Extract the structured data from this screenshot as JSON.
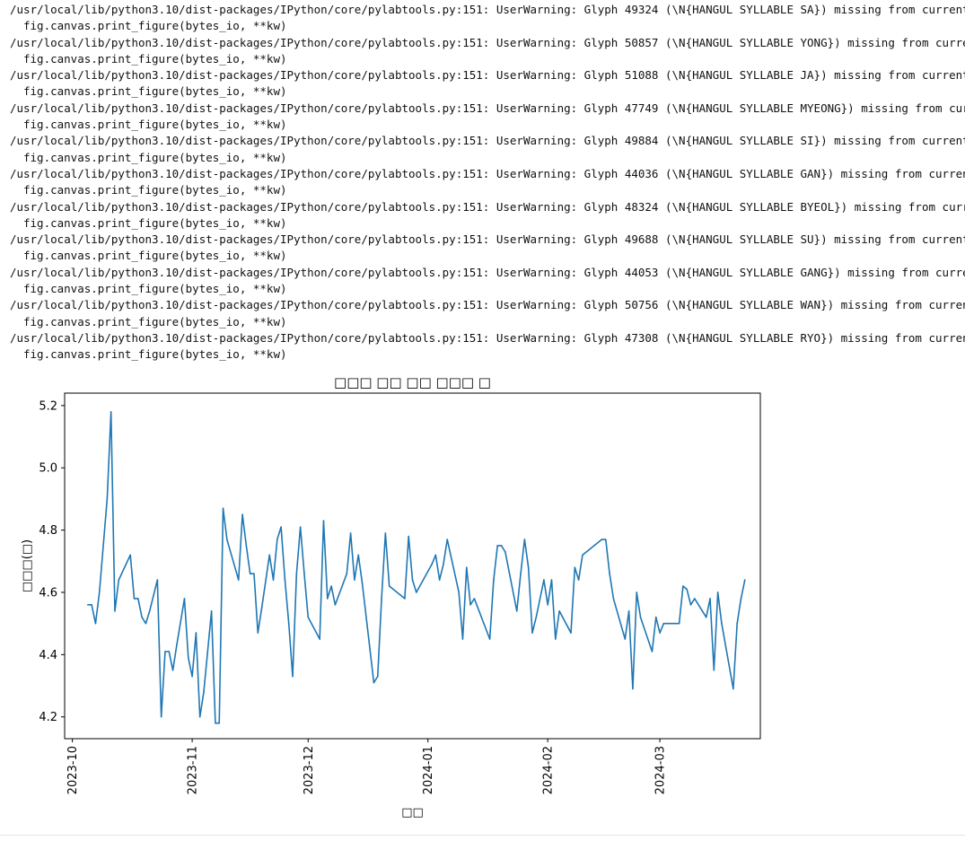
{
  "output": {
    "warnings": [
      {
        "line": "/usr/local/lib/python3.10/dist-packages/IPython/core/pylabtools.py:151: UserWarning: Glyph 49324 (\\N{HANGUL SYLLABLE SA}) missing from current font.",
        "cont": "fig.canvas.print_figure(bytes_io, **kw)"
      },
      {
        "line": "/usr/local/lib/python3.10/dist-packages/IPython/core/pylabtools.py:151: UserWarning: Glyph 50857 (\\N{HANGUL SYLLABLE YONG}) missing from current font.",
        "cont": "fig.canvas.print_figure(bytes_io, **kw)"
      },
      {
        "line": "/usr/local/lib/python3.10/dist-packages/IPython/core/pylabtools.py:151: UserWarning: Glyph 51088 (\\N{HANGUL SYLLABLE JA}) missing from current font.",
        "cont": "fig.canvas.print_figure(bytes_io, **kw)"
      },
      {
        "line": "/usr/local/lib/python3.10/dist-packages/IPython/core/pylabtools.py:151: UserWarning: Glyph 47749 (\\N{HANGUL SYLLABLE MYEONG}) missing from current font.",
        "cont": "fig.canvas.print_figure(bytes_io, **kw)"
      },
      {
        "line": "/usr/local/lib/python3.10/dist-packages/IPython/core/pylabtools.py:151: UserWarning: Glyph 49884 (\\N{HANGUL SYLLABLE SI}) missing from current font.",
        "cont": "fig.canvas.print_figure(bytes_io, **kw)"
      },
      {
        "line": "/usr/local/lib/python3.10/dist-packages/IPython/core/pylabtools.py:151: UserWarning: Glyph 44036 (\\N{HANGUL SYLLABLE GAN}) missing from current font.",
        "cont": "fig.canvas.print_figure(bytes_io, **kw)"
      },
      {
        "line": "/usr/local/lib/python3.10/dist-packages/IPython/core/pylabtools.py:151: UserWarning: Glyph 48324 (\\N{HANGUL SYLLABLE BYEOL}) missing from current font.",
        "cont": "fig.canvas.print_figure(bytes_io, **kw)"
      },
      {
        "line": "/usr/local/lib/python3.10/dist-packages/IPython/core/pylabtools.py:151: UserWarning: Glyph 49688 (\\N{HANGUL SYLLABLE SU}) missing from current font.",
        "cont": "fig.canvas.print_figure(bytes_io, **kw)"
      },
      {
        "line": "/usr/local/lib/python3.10/dist-packages/IPython/core/pylabtools.py:151: UserWarning: Glyph 44053 (\\N{HANGUL SYLLABLE GANG}) missing from current font.",
        "cont": "fig.canvas.print_figure(bytes_io, **kw)"
      },
      {
        "line": "/usr/local/lib/python3.10/dist-packages/IPython/core/pylabtools.py:151: UserWarning: Glyph 50756 (\\N{HANGUL SYLLABLE WAN}) missing from current font.",
        "cont": "fig.canvas.print_figure(bytes_io, **kw)"
      },
      {
        "line": "/usr/local/lib/python3.10/dist-packages/IPython/core/pylabtools.py:151: UserWarning: Glyph 47308 (\\N{HANGUL SYLLABLE RYO}) missing from current font.",
        "cont": "fig.canvas.print_figure(bytes_io, **kw)"
      }
    ]
  },
  "chart_data": {
    "type": "line",
    "title": "□□□ □□ □□ □□□ □",
    "xlabel": "□□",
    "ylabel": "□□□(□)",
    "line_color": "#1f77b4",
    "xlim": [
      "2023-09-29",
      "2024-03-27"
    ],
    "ylim": [
      4.13,
      5.24
    ],
    "x_ticks": [
      "2023-10",
      "2023-11",
      "2023-12",
      "2024-01",
      "2024-02",
      "2024-03"
    ],
    "y_ticks": [
      "4.2",
      "4.4",
      "4.6",
      "4.8",
      "5.0",
      "5.2"
    ],
    "y_tick_values": [
      4.2,
      4.4,
      4.6,
      4.8,
      5.0,
      5.2
    ],
    "grid": false,
    "series": [
      {
        "points": [
          [
            "2023-10-05",
            4.56
          ],
          [
            "2023-10-06",
            4.56
          ],
          [
            "2023-10-07",
            4.5
          ],
          [
            "2023-10-08",
            4.6
          ],
          [
            "2023-10-10",
            4.9
          ],
          [
            "2023-10-11",
            5.18
          ],
          [
            "2023-10-12",
            4.54
          ],
          [
            "2023-10-13",
            4.64
          ],
          [
            "2023-10-16",
            4.72
          ],
          [
            "2023-10-17",
            4.58
          ],
          [
            "2023-10-18",
            4.58
          ],
          [
            "2023-10-19",
            4.52
          ],
          [
            "2023-10-20",
            4.5
          ],
          [
            "2023-10-21",
            4.54
          ],
          [
            "2023-10-23",
            4.64
          ],
          [
            "2023-10-24",
            4.2
          ],
          [
            "2023-10-25",
            4.41
          ],
          [
            "2023-10-26",
            4.41
          ],
          [
            "2023-10-27",
            4.35
          ],
          [
            "2023-10-28",
            4.43
          ],
          [
            "2023-10-30",
            4.58
          ],
          [
            "2023-10-31",
            4.39
          ],
          [
            "2023-11-01",
            4.33
          ],
          [
            "2023-11-02",
            4.47
          ],
          [
            "2023-11-03",
            4.2
          ],
          [
            "2023-11-04",
            4.28
          ],
          [
            "2023-11-06",
            4.54
          ],
          [
            "2023-11-07",
            4.18
          ],
          [
            "2023-11-08",
            4.18
          ],
          [
            "2023-11-09",
            4.87
          ],
          [
            "2023-11-10",
            4.77
          ],
          [
            "2023-11-13",
            4.64
          ],
          [
            "2023-11-14",
            4.85
          ],
          [
            "2023-11-15",
            4.75
          ],
          [
            "2023-11-16",
            4.66
          ],
          [
            "2023-11-17",
            4.66
          ],
          [
            "2023-11-18",
            4.47
          ],
          [
            "2023-11-19",
            4.55
          ],
          [
            "2023-11-21",
            4.72
          ],
          [
            "2023-11-22",
            4.64
          ],
          [
            "2023-11-23",
            4.77
          ],
          [
            "2023-11-24",
            4.81
          ],
          [
            "2023-11-25",
            4.64
          ],
          [
            "2023-11-26",
            4.5
          ],
          [
            "2023-11-27",
            4.33
          ],
          [
            "2023-11-28",
            4.66
          ],
          [
            "2023-11-29",
            4.81
          ],
          [
            "2023-11-30",
            4.66
          ],
          [
            "2023-12-01",
            4.52
          ],
          [
            "2023-12-04",
            4.45
          ],
          [
            "2023-12-05",
            4.83
          ],
          [
            "2023-12-06",
            4.58
          ],
          [
            "2023-12-07",
            4.62
          ],
          [
            "2023-12-08",
            4.56
          ],
          [
            "2023-12-11",
            4.66
          ],
          [
            "2023-12-12",
            4.79
          ],
          [
            "2023-12-13",
            4.64
          ],
          [
            "2023-12-14",
            4.72
          ],
          [
            "2023-12-15",
            4.63
          ],
          [
            "2023-12-18",
            4.31
          ],
          [
            "2023-12-19",
            4.33
          ],
          [
            "2023-12-20",
            4.58
          ],
          [
            "2023-12-21",
            4.79
          ],
          [
            "2023-12-22",
            4.62
          ],
          [
            "2023-12-26",
            4.58
          ],
          [
            "2023-12-27",
            4.78
          ],
          [
            "2023-12-28",
            4.64
          ],
          [
            "2023-12-29",
            4.6
          ],
          [
            "2024-01-02",
            4.69
          ],
          [
            "2024-01-03",
            4.72
          ],
          [
            "2024-01-04",
            4.64
          ],
          [
            "2024-01-05",
            4.69
          ],
          [
            "2024-01-06",
            4.77
          ],
          [
            "2024-01-09",
            4.6
          ],
          [
            "2024-01-10",
            4.45
          ],
          [
            "2024-01-11",
            4.68
          ],
          [
            "2024-01-12",
            4.56
          ],
          [
            "2024-01-13",
            4.58
          ],
          [
            "2024-01-17",
            4.45
          ],
          [
            "2024-01-18",
            4.64
          ],
          [
            "2024-01-19",
            4.75
          ],
          [
            "2024-01-20",
            4.75
          ],
          [
            "2024-01-21",
            4.73
          ],
          [
            "2024-01-24",
            4.54
          ],
          [
            "2024-01-25",
            4.66
          ],
          [
            "2024-01-26",
            4.77
          ],
          [
            "2024-01-27",
            4.68
          ],
          [
            "2024-01-28",
            4.47
          ],
          [
            "2024-01-29",
            4.52
          ],
          [
            "2024-01-31",
            4.64
          ],
          [
            "2024-02-01",
            4.56
          ],
          [
            "2024-02-02",
            4.64
          ],
          [
            "2024-02-03",
            4.45
          ],
          [
            "2024-02-04",
            4.54
          ],
          [
            "2024-02-07",
            4.47
          ],
          [
            "2024-02-08",
            4.68
          ],
          [
            "2024-02-09",
            4.64
          ],
          [
            "2024-02-10",
            4.72
          ],
          [
            "2024-02-15",
            4.77
          ],
          [
            "2024-02-16",
            4.77
          ],
          [
            "2024-02-17",
            4.66
          ],
          [
            "2024-02-18",
            4.58
          ],
          [
            "2024-02-21",
            4.45
          ],
          [
            "2024-02-22",
            4.54
          ],
          [
            "2024-02-23",
            4.29
          ],
          [
            "2024-02-24",
            4.6
          ],
          [
            "2024-02-25",
            4.52
          ],
          [
            "2024-02-28",
            4.41
          ],
          [
            "2024-02-29",
            4.52
          ],
          [
            "2024-03-01",
            4.47
          ],
          [
            "2024-03-02",
            4.5
          ],
          [
            "2024-03-03",
            4.5
          ],
          [
            "2024-03-06",
            4.5
          ],
          [
            "2024-03-07",
            4.62
          ],
          [
            "2024-03-08",
            4.61
          ],
          [
            "2024-03-09",
            4.56
          ],
          [
            "2024-03-10",
            4.58
          ],
          [
            "2024-03-13",
            4.52
          ],
          [
            "2024-03-14",
            4.58
          ],
          [
            "2024-03-15",
            4.35
          ],
          [
            "2024-03-16",
            4.6
          ],
          [
            "2024-03-17",
            4.5
          ],
          [
            "2024-03-20",
            4.29
          ],
          [
            "2024-03-21",
            4.5
          ],
          [
            "2024-03-22",
            4.58
          ],
          [
            "2024-03-23",
            4.64
          ]
        ]
      }
    ]
  }
}
